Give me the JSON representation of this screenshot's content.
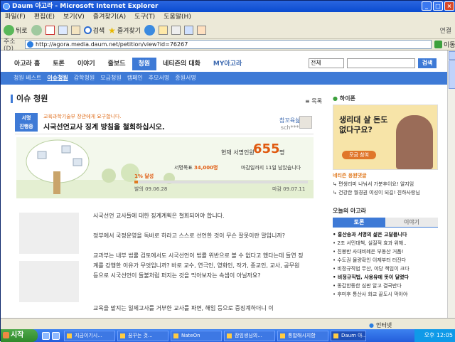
{
  "window": {
    "title": "Daum 아고라 - Microsoft Internet Explorer"
  },
  "menu": [
    "파일(F)",
    "편집(E)",
    "보기(V)",
    "즐겨찾기(A)",
    "도구(T)",
    "도움말(H)"
  ],
  "toolbar": {
    "back": "뒤로",
    "search": "검색",
    "favorites": "즐겨찾기",
    "links": "연결"
  },
  "address": {
    "label": "주소(D)",
    "url": "http://agora.media.daum.net/petition/view?id=76267",
    "go": "이동"
  },
  "nav": {
    "tabs": [
      "아고라 홈",
      "토론",
      "이야기",
      "줄보드",
      "청원",
      "네티즌의 대화",
      "MY아고라"
    ],
    "search_select": "전체",
    "search_btn": "검색"
  },
  "subnav": [
    "청원 베스트",
    "이슈청원",
    "감학청원",
    "모금청원",
    "캠페인",
    "추모서명",
    "종원서명"
  ],
  "section": {
    "title": "이슈 청원",
    "list": "목록"
  },
  "petition": {
    "badge1": "서명",
    "badge2": "진행중",
    "to": "교육과학기술부 장관에게 요구합니다.",
    "title": "시국선언교사 징계 방침을 철회하십시오.",
    "author": "참꼬육삶",
    "author_id": "sch***",
    "count_label": "현재 서명인원",
    "count": "655",
    "count_unit": "명",
    "goal_label": "서명목표",
    "goal": "34,000명",
    "deadline": "마감일까지 11일 남았습니다",
    "progress_label": "1% 달성",
    "progress": 0.02,
    "start": "발의 09.06.28",
    "end": "마감 09.07.11"
  },
  "body": [
    "시국선언 교사들에 대한 징계계획은 철회되어야 합니다.",
    "정부에서 국정운영을 독바로 하라고 스스로 선언한 것이 무슨 잘못이란 말입니까?",
    "교과부는 내부 법률 검토에서도 시국선언이 법률 위반으로 볼 수 없다고 했다는데 들연 징계를 강행한 이유가 무엇입니까? 바로 교수, 연극인, 영화인, 작가, 종교인, 교사, 공무원 등으로 시국선언이 들불처럼 퍼지는 것을 막아보자는 속셈이 아닐까요?",
    "교육을 맡지는 일제고사를 거부한 교사를 파면, 해임 등으로 중징계하더니 이"
  ],
  "sidebar": {
    "ad_head": "하이폰",
    "ad_text": "생리대 살 돈도 없다구요?",
    "ad_btn": "모금 참여",
    "links": [
      {
        "text": "네티즌 응원댓글"
      },
      {
        "text": "↳ 편생리미 나눠서 가분후이요!  알지임"
      },
      {
        "text": "↳ 건강한 월경권 여성이 되길!  진하사랑님"
      }
    ],
    "today_title": "오늘의 아고라",
    "today_tabs": [
      "토론",
      "이야기"
    ],
    "today_items": [
      "• 홍산송과 서명의 삶은 고달픕니다",
      "• 2조 서민대책, 실질적 효과 위해..",
      "• 진봉반 사대비례은 부동산 거품!",
      "• 수도권 물량확인 이제부터 터진다",
      "• 비정규직법 무산, 야당 책임이 크다",
      "• 비정규직법, 사용유에 뜻이 달렸다",
      "• 동갑한동한 심판 알고 결국반다",
      "• 후미후 통산사 화교 끝도시 막아야"
    ]
  },
  "status": {
    "zone": "인터넷"
  },
  "taskbar": {
    "start": "시작",
    "tasks": [
      "지금이기시...",
      "꿈꾸는 것...",
      "NateOn",
      "잠임생님의...",
      "통합해시지함",
      "Daum 아..."
    ],
    "clock": "오후 12:05"
  }
}
